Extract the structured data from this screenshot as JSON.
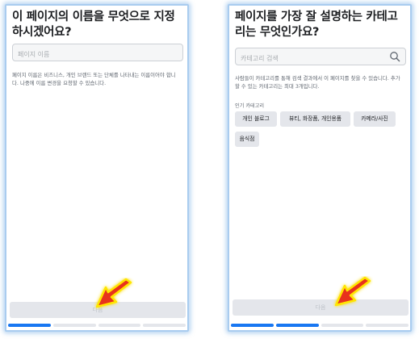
{
  "left_screen": {
    "title": "이 페이지의 이름을 무엇으로 지정하시겠어요?",
    "name_input": {
      "value": "",
      "placeholder": "페이지 이름"
    },
    "help_text": "페이지 이름은 비즈니스, 개인 브랜드 또는 단체를 나타내는 이름이어야 합니다. 나중에 이름 변경을 요청할 수 있습니다.",
    "next_label": "다음",
    "progress": {
      "steps": 4,
      "completed": 1
    }
  },
  "right_screen": {
    "title": "페이지를 가장 잘 설명하는 카테고리는 무엇인가요?",
    "category_input": {
      "value": "",
      "placeholder": "카테고리 검색"
    },
    "help_text": "사람들이 카테고리를 통해 검색 결과에서 이 페이지를 찾을 수 있습니다. 추가할 수 있는 카테고리는 최대 3개입니다.",
    "popular_label": "인기 카테고리",
    "chips": [
      "개인 블로그",
      "뷰티, 화장품, 개인용품",
      "카메라/사진",
      "음식점"
    ],
    "next_label": "다음",
    "progress": {
      "steps": 4,
      "completed": 2
    }
  },
  "icons": {
    "search": "search-icon",
    "pointer": "red-arrow-icon"
  },
  "colors": {
    "accent": "#1877f2",
    "frame_glow": "#a9ccef",
    "arrow": "#e8321e",
    "arrow_glow": "#ffe600"
  }
}
